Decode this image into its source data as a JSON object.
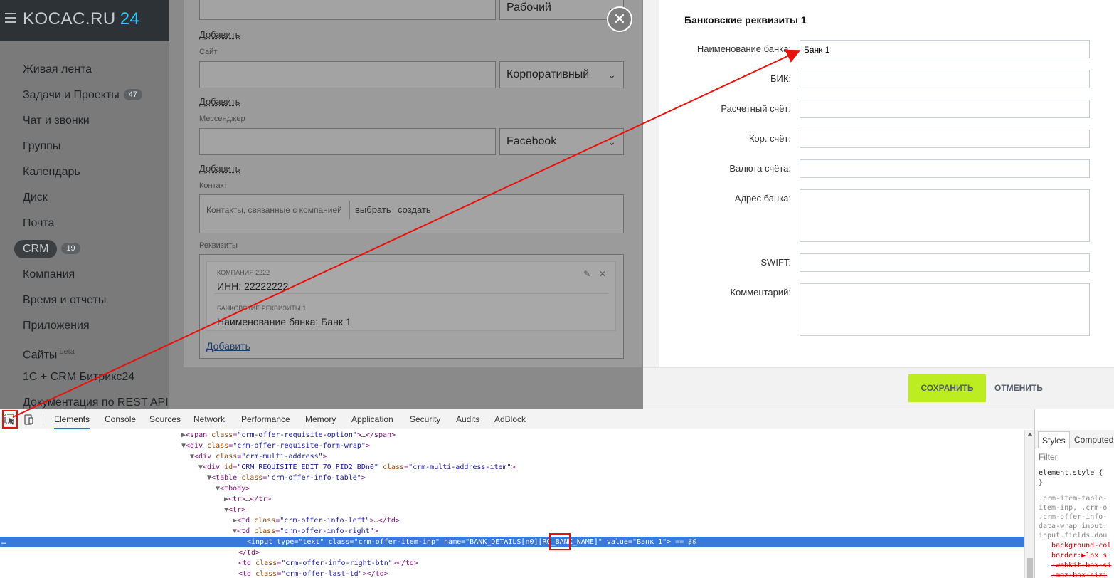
{
  "sidebar": {
    "logo": "KOCAC.RU",
    "logo_num": "24",
    "items": [
      {
        "label": "Живая лента"
      },
      {
        "label": "Задачи и Проекты",
        "badge": "47"
      },
      {
        "label": "Чат и звонки"
      },
      {
        "label": "Группы"
      },
      {
        "label": "Календарь"
      },
      {
        "label": "Диск"
      },
      {
        "label": "Почта"
      },
      {
        "label": "CRM",
        "badge": "19",
        "active": true
      },
      {
        "label": "Компания"
      },
      {
        "label": "Время и отчеты"
      },
      {
        "label": "Приложения"
      },
      {
        "label": "Сайты",
        "sup": "beta"
      },
      {
        "label": "1С + CRM Битрикс24"
      },
      {
        "label": "Документация по REST API"
      }
    ]
  },
  "form": {
    "select_work": "Рабочий",
    "add_1": "Добавить",
    "site_label": "Сайт",
    "select_corp": "Корпоративный",
    "add_2": "Добавить",
    "messenger_label": "Мессенджер",
    "select_facebook": "Facebook",
    "add_3": "Добавить",
    "contact_label": "Контакт",
    "contact_placeholder": "Контакты, связанные с компанией",
    "contact_select": "выбрать",
    "contact_create": "создать",
    "requisites_label": "Реквизиты",
    "req_company": "КОМПАНИЯ 2222",
    "req_inn": "ИНН: 22222222",
    "req_bank_title": "БАНКОВСКИЕ РЕКВИЗИТЫ 1",
    "req_bank_name": "Наименование банка: Банк 1",
    "req_add": "Добавить"
  },
  "bank": {
    "title": "Банковские реквизиты 1",
    "fields": [
      {
        "label": "Наименование банка:",
        "value": "Банк 1"
      },
      {
        "label": "БИК:",
        "value": ""
      },
      {
        "label": "Расчетный счёт:",
        "value": ""
      },
      {
        "label": "Кор. счёт:",
        "value": ""
      },
      {
        "label": "Валюта счёта:",
        "value": ""
      },
      {
        "label": "Адрес банка:",
        "value": ""
      },
      {
        "label": "SWIFT:",
        "value": ""
      },
      {
        "label": "Комментарий:",
        "value": ""
      }
    ],
    "save": "СОХРАНИТЬ",
    "cancel": "ОТМЕНИТЬ"
  },
  "devtools": {
    "tabs": [
      "Elements",
      "Console",
      "Sources",
      "Network",
      "Performance",
      "Memory",
      "Application",
      "Security",
      "Audits",
      "AdBlock"
    ],
    "active_tab": "Elements",
    "styles_tabs": [
      "Styles",
      "Computed"
    ],
    "filter_placeholder": "Filter",
    "dom_lines": [
      "<span class=\"crm-offer-requisite-option\">…</span>",
      "<div class=\"crm-offer-requisite-form-wrap\">",
      "<div class=\"crm-multi-address\">",
      "<div id=\"CRM_REQUISITE_EDIT_70_PID2_BDn0\" class=\"crm-multi-address-item\">",
      "<table class=\"crm-offer-info-table\">",
      "<tbody>",
      "<tr>…</tr>",
      "<tr>",
      "<td class=\"crm-offer-info-left\">…</td>",
      "<td class=\"crm-offer-info-right\">",
      "<input type=\"text\" class=\"crm-offer-item-inp\" name=\"BANK_DETAILS[n0][RQ_BANK_NAME]\" value=\"Банк 1\"> == $0",
      "</td>",
      "<td class=\"crm-offer-info-right-btn\"></td>",
      "<td class=\"crm-offer-last-td\"></td>"
    ],
    "styles_lines": [
      "element.style {",
      "}",
      ".crm-item-table-",
      "item-inp, .crm-o",
      ".crm-offer-info-",
      "data-wrap input.",
      "input.fields.dou",
      "background-col",
      "border:▶1px s",
      "-webkit-box-si",
      "-moz-box-sizi"
    ]
  },
  "colors": {
    "accent_save": "#bbed21",
    "annotation": "#e8120c",
    "devtools_selection": "#3879d9"
  }
}
